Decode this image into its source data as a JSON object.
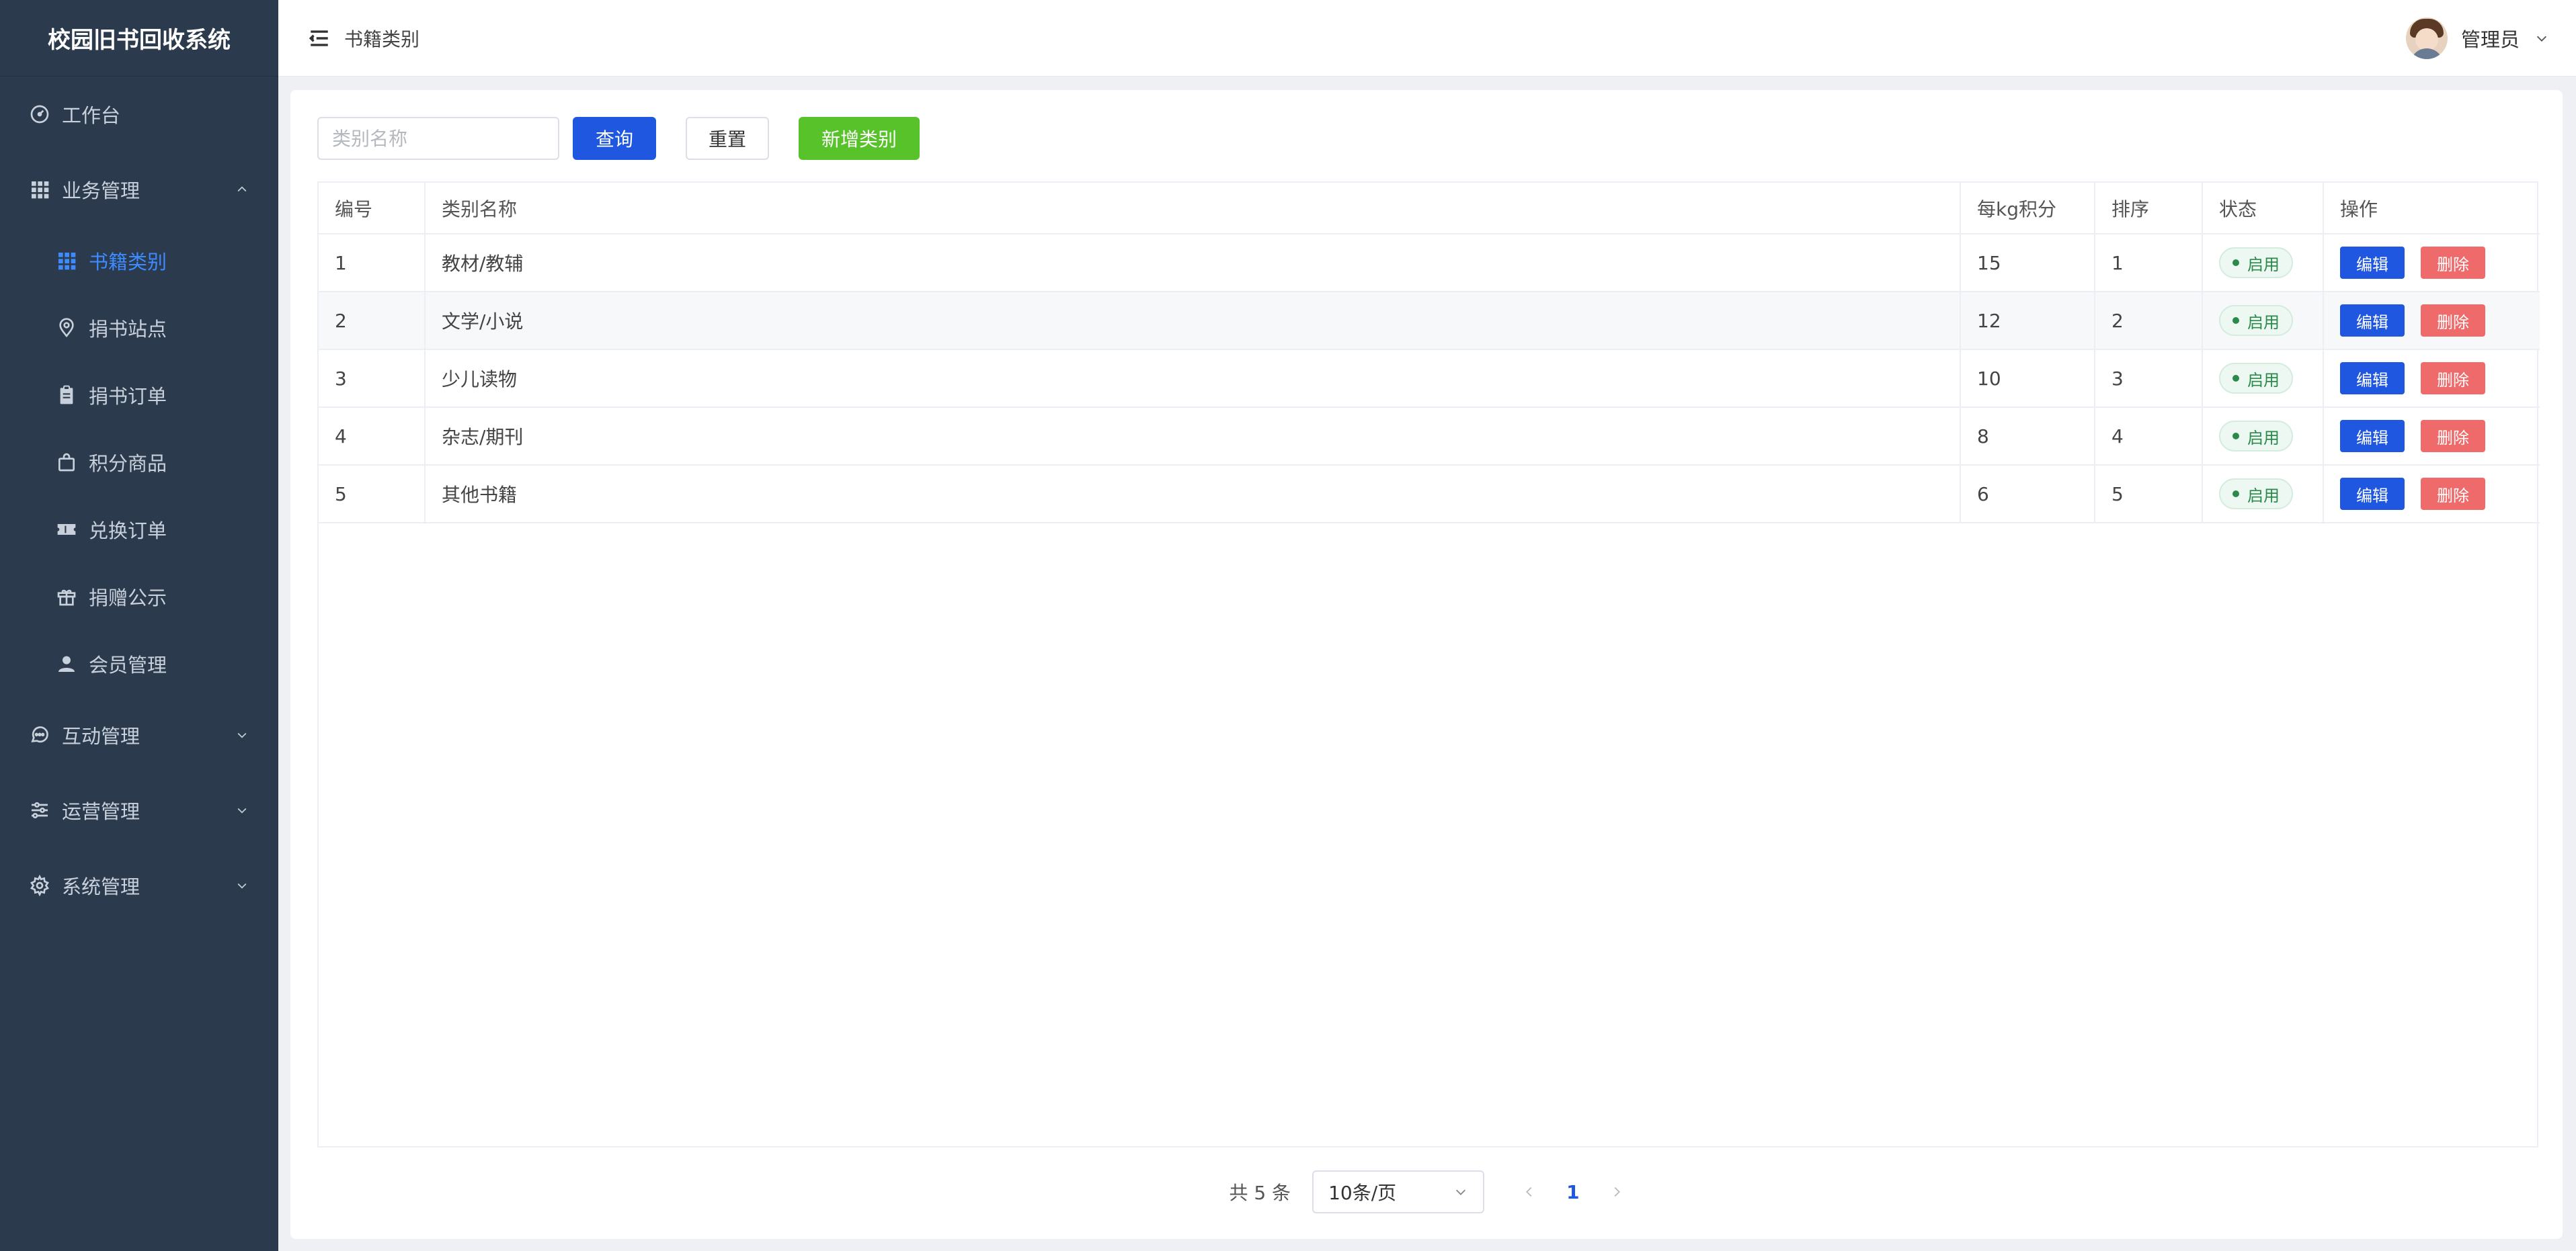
{
  "app": {
    "title": "校园旧书回收系统"
  },
  "sidebar": {
    "items": [
      {
        "label": "工作台",
        "icon": "dashboard-icon"
      },
      {
        "label": "业务管理",
        "icon": "grid-icon",
        "expanded": true
      },
      {
        "label": "互动管理",
        "icon": "chat-icon"
      },
      {
        "label": "运营管理",
        "icon": "sliders-icon"
      },
      {
        "label": "系统管理",
        "icon": "gear-icon"
      }
    ],
    "submenu": [
      {
        "label": "书籍类别",
        "icon": "grid-icon",
        "active": true
      },
      {
        "label": "捐书站点",
        "icon": "location-icon"
      },
      {
        "label": "捐书订单",
        "icon": "clipboard-icon"
      },
      {
        "label": "积分商品",
        "icon": "bag-icon"
      },
      {
        "label": "兑换订单",
        "icon": "ticket-icon"
      },
      {
        "label": "捐赠公示",
        "icon": "gift-icon"
      },
      {
        "label": "会员管理",
        "icon": "user-icon"
      }
    ]
  },
  "header": {
    "breadcrumb": "书籍类别",
    "user_name": "管理员"
  },
  "toolbar": {
    "search_placeholder": "类别名称",
    "query_label": "查询",
    "reset_label": "重置",
    "add_label": "新增类别"
  },
  "table": {
    "columns": [
      "编号",
      "类别名称",
      "每kg积分",
      "排序",
      "状态",
      "操作"
    ],
    "rows": [
      {
        "id": "1",
        "name": "教材/教辅",
        "points": "15",
        "sort": "1",
        "status": "启用"
      },
      {
        "id": "2",
        "name": "文学/小说",
        "points": "12",
        "sort": "2",
        "status": "启用"
      },
      {
        "id": "3",
        "name": "少儿读物",
        "points": "10",
        "sort": "3",
        "status": "启用"
      },
      {
        "id": "4",
        "name": "杂志/期刊",
        "points": "8",
        "sort": "4",
        "status": "启用"
      },
      {
        "id": "5",
        "name": "其他书籍",
        "points": "6",
        "sort": "5",
        "status": "启用"
      }
    ],
    "edit_label": "编辑",
    "delete_label": "删除"
  },
  "pagination": {
    "total": "共 5 条",
    "page_size": "10条/页",
    "current_page": "1"
  },
  "colors": {
    "sidebar_bg": "#2b3a4c",
    "primary": "#1f57e0",
    "success": "#58c22b",
    "danger": "#ef6b6b",
    "active_menu": "#3d8bff"
  }
}
